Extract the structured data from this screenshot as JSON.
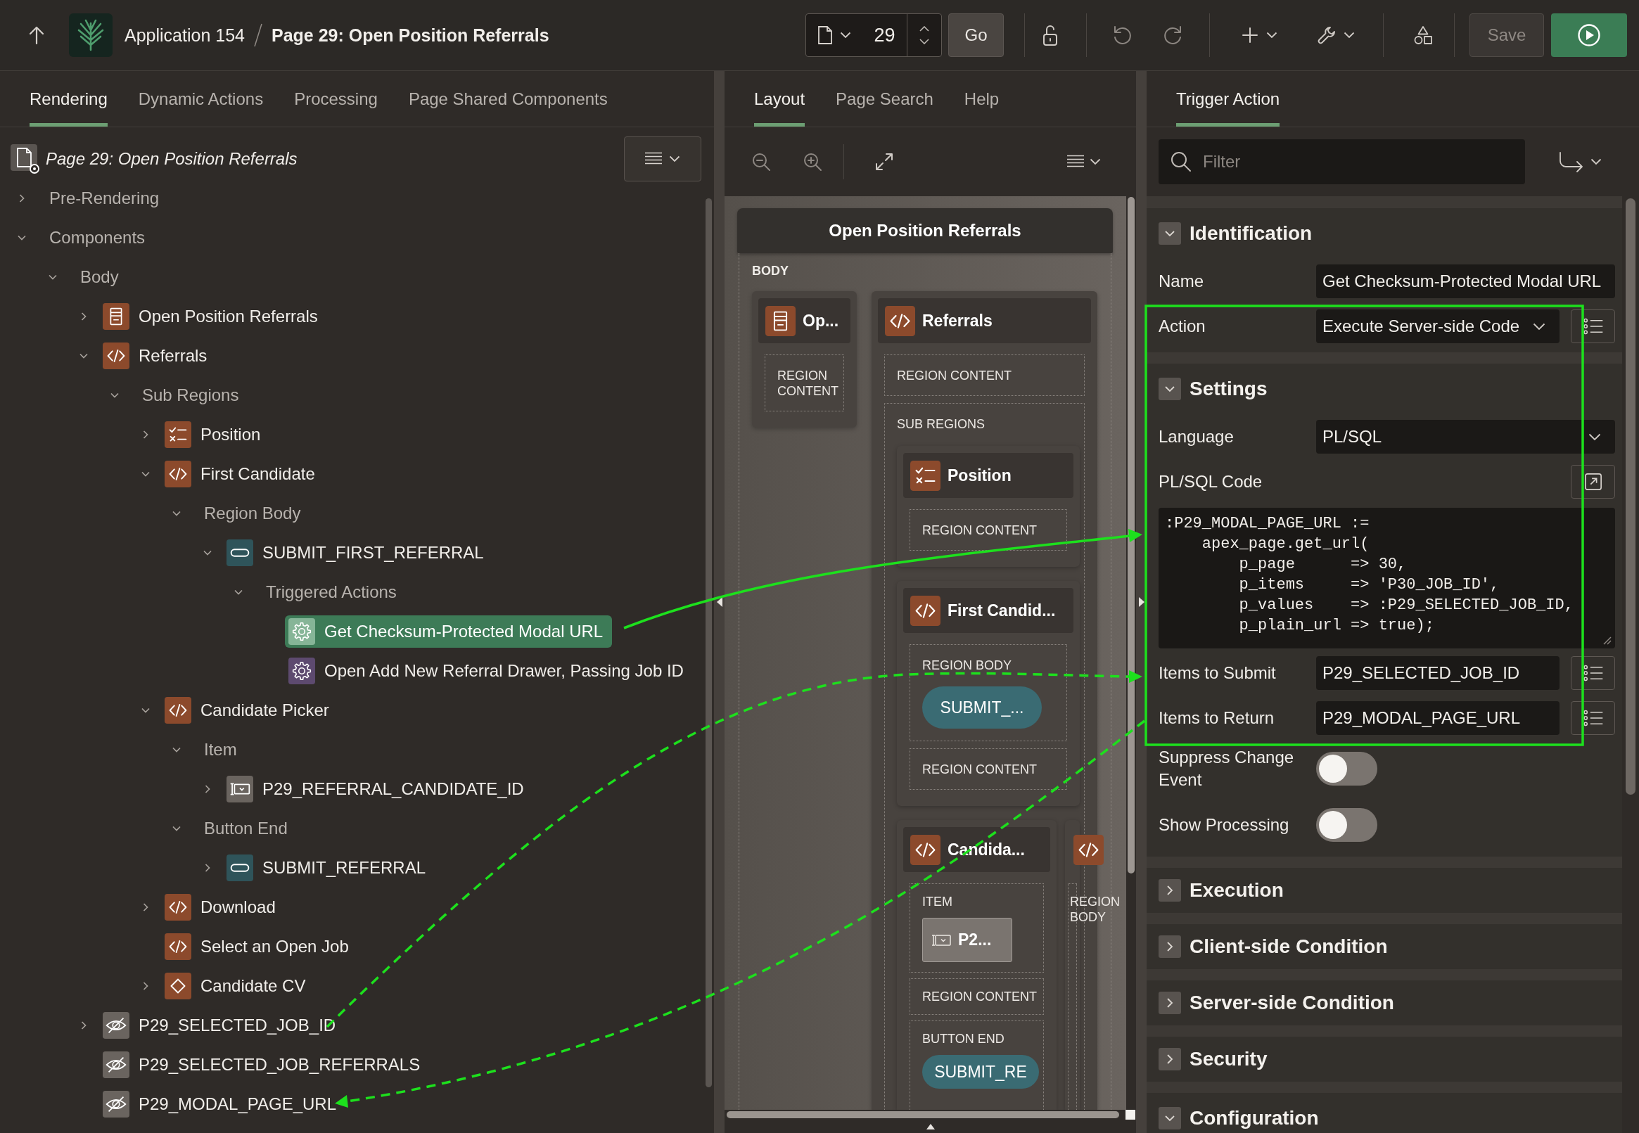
{
  "toolbar": {
    "app": "Application 154",
    "page": "Page 29: Open Position Referrals",
    "page_number": "29",
    "go_button": "Go",
    "save_button": "Save"
  },
  "rendering": {
    "tabs": [
      {
        "label": "Rendering",
        "selected": true
      },
      {
        "label": "Dynamic Actions",
        "selected": false
      },
      {
        "label": "Processing",
        "selected": false
      },
      {
        "label": "Page Shared Components",
        "selected": false
      }
    ],
    "page_node": "Page 29: Open Position Referrals",
    "tree": [
      {
        "label": "Pre-Rendering",
        "kind": "group",
        "expanded": false,
        "selected": false
      },
      {
        "label": "Components",
        "kind": "group",
        "expanded": true,
        "selected": false,
        "children": [
          {
            "label": "Body",
            "kind": "group",
            "expanded": true,
            "selected": false,
            "children": [
              {
                "label": "Open Position Referrals",
                "kind": "report",
                "expanded": false,
                "selected": false
              },
              {
                "label": "Referrals",
                "kind": "code",
                "expanded": true,
                "selected": false,
                "children": [
                  {
                    "label": "Sub Regions",
                    "kind": "group",
                    "expanded": true,
                    "selected": false,
                    "children": [
                      {
                        "label": "Position",
                        "kind": "checklist",
                        "expanded": false,
                        "selected": false
                      },
                      {
                        "label": "First Candidate",
                        "kind": "code",
                        "expanded": true,
                        "selected": false,
                        "children": [
                          {
                            "label": "Region Body",
                            "kind": "group",
                            "expanded": true,
                            "selected": false,
                            "children": [
                              {
                                "label": "SUBMIT_FIRST_REFERRAL",
                                "kind": "button",
                                "expanded": true,
                                "selected": false,
                                "children": [
                                  {
                                    "label": "Triggered Actions",
                                    "kind": "group",
                                    "expanded": true,
                                    "selected": false,
                                    "children": [
                                      {
                                        "label": "Get Checksum-Protected Modal URL",
                                        "kind": "action",
                                        "selected": true
                                      },
                                      {
                                        "label": "Open Add New Referral Drawer, Passing Job ID",
                                        "kind": "action",
                                        "selected": false
                                      }
                                    ]
                                  }
                                ]
                              }
                            ]
                          }
                        ]
                      },
                      {
                        "label": "Candidate Picker",
                        "kind": "code",
                        "expanded": true,
                        "selected": false,
                        "children": [
                          {
                            "label": "Item",
                            "kind": "group",
                            "expanded": true,
                            "selected": false,
                            "children": [
                              {
                                "label": "P29_REFERRAL_CANDIDATE_ID",
                                "kind": "select",
                                "expanded": false,
                                "selected": false
                              }
                            ]
                          },
                          {
                            "label": "Button End",
                            "kind": "group",
                            "expanded": true,
                            "selected": false,
                            "children": [
                              {
                                "label": "SUBMIT_REFERRAL",
                                "kind": "button",
                                "expanded": false,
                                "selected": false
                              }
                            ]
                          }
                        ]
                      },
                      {
                        "label": "Download",
                        "kind": "code",
                        "expanded": false,
                        "selected": false
                      },
                      {
                        "label": "Select an Open Job",
                        "kind": "code",
                        "selected": false
                      },
                      {
                        "label": "Candidate CV",
                        "kind": "diamond",
                        "expanded": false,
                        "selected": false
                      }
                    ]
                  }
                ]
              },
              {
                "label": "P29_SELECTED_JOB_ID",
                "kind": "hidden",
                "expanded": false,
                "selected": false
              },
              {
                "label": "P29_SELECTED_JOB_REFERRALS",
                "kind": "hidden",
                "selected": false
              },
              {
                "label": "P29_MODAL_PAGE_URL",
                "kind": "hidden",
                "selected": false
              }
            ]
          }
        ]
      }
    ]
  },
  "layout": {
    "tabs": [
      {
        "label": "Layout",
        "selected": true
      },
      {
        "label": "Page Search",
        "selected": false
      },
      {
        "label": "Help",
        "selected": false
      }
    ],
    "page_title": "Open Position Referrals",
    "body_label": "BODY",
    "regions": [
      {
        "kind": "report",
        "title": "Op...",
        "slots": [
          {
            "label": "REGION CONTENT"
          }
        ]
      },
      {
        "kind": "code",
        "title": "Referrals",
        "slots": [
          {
            "label": "REGION CONTENT"
          },
          {
            "label": "SUB REGIONS",
            "regions": [
              {
                "kind": "checklist",
                "title": "Position",
                "slots": [
                  {
                    "label": "REGION CONTENT"
                  }
                ]
              },
              {
                "kind": "code",
                "title": "First Candid...",
                "slots": [
                  {
                    "label": "REGION BODY",
                    "items": [
                      {
                        "kind": "button",
                        "label": "SUBMIT_..."
                      }
                    ]
                  },
                  {
                    "label": "REGION CONTENT"
                  }
                ]
              },
              {
                "kind": "code",
                "title": "Candida...",
                "slots": [
                  {
                    "label": "ITEM",
                    "items": [
                      {
                        "kind": "select",
                        "label": "P2..."
                      }
                    ]
                  },
                  {
                    "label": "REGION CONTENT"
                  },
                  {
                    "label": "BUTTON END",
                    "items": [
                      {
                        "kind": "button",
                        "label": "SUBMIT_RE"
                      }
                    ]
                  }
                ]
              },
              {
                "kind": "code",
                "slots": [
                  {
                    "label": "REGION BODY"
                  }
                ]
              }
            ]
          }
        ]
      }
    ]
  },
  "properties": {
    "tabs": [
      {
        "label": "Trigger Action",
        "selected": true
      }
    ],
    "filter": {
      "placeholder": "Filter"
    },
    "sections": [
      {
        "title": "Identification",
        "expanded": true,
        "rows": [
          {
            "kind": "text",
            "label": "Name",
            "value": "Get Checksum-Protected Modal URL"
          },
          {
            "kind": "select",
            "label": "Action",
            "value": "Execute Server-side Code",
            "list_button": true
          }
        ]
      },
      {
        "title": "Settings",
        "expanded": true,
        "rows": [
          {
            "kind": "select",
            "label": "Language",
            "value": "PL/SQL"
          },
          {
            "kind": "code",
            "label": "PL/SQL Code",
            "value": ":P29_MODAL_PAGE_URL :=\n    apex_page.get_url(\n        p_page      => 30,\n        p_items     => 'P30_JOB_ID',\n        p_values    => :P29_SELECTED_JOB_ID,\n        p_plain_url => true);"
          },
          {
            "kind": "text",
            "label": "Items to Submit",
            "value": "P29_SELECTED_JOB_ID",
            "list_button": true
          },
          {
            "kind": "text",
            "label": "Items to Return",
            "value": "P29_MODAL_PAGE_URL",
            "list_button": true
          },
          {
            "kind": "switch",
            "label": "Suppress Change Event",
            "on": false
          },
          {
            "kind": "switch",
            "label": "Show Processing",
            "on": false
          }
        ]
      },
      {
        "title": "Execution",
        "expanded": false
      },
      {
        "title": "Client-side Condition",
        "expanded": false
      },
      {
        "title": "Server-side Condition",
        "expanded": false
      },
      {
        "title": "Security",
        "expanded": false
      },
      {
        "title": "Configuration",
        "expanded": true
      }
    ]
  },
  "annotations": [
    {
      "kind": "frame"
    },
    {
      "kind": "solid-arrow"
    },
    {
      "kind": "dashed-arrow"
    },
    {
      "kind": "dashed-arrow"
    }
  ]
}
